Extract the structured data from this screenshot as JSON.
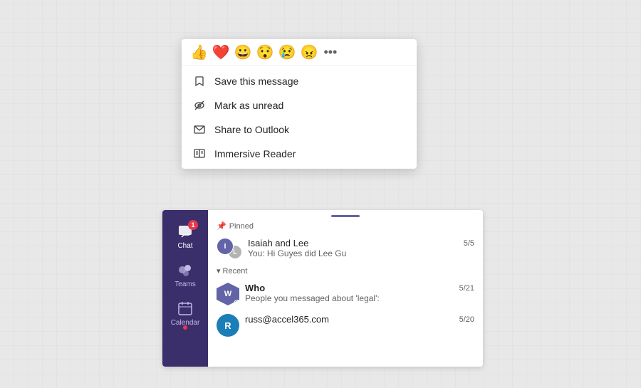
{
  "popup": {
    "reactions": [
      "👍",
      "❤️",
      "😀",
      "😯",
      "😢",
      "😠"
    ],
    "more_icon": "•••",
    "menu_items": [
      {
        "id": "save",
        "label": "Save this message",
        "icon": "bookmark"
      },
      {
        "id": "unread",
        "label": "Mark as unread",
        "icon": "eye-slash"
      },
      {
        "id": "outlook",
        "label": "Share to Outlook",
        "icon": "envelope"
      },
      {
        "id": "immersive",
        "label": "Immersive Reader",
        "icon": "reader"
      }
    ]
  },
  "sidebar": {
    "items": [
      {
        "id": "chat",
        "label": "Chat",
        "badge": "1",
        "icon": "chat"
      },
      {
        "id": "teams",
        "label": "Teams",
        "badge": null,
        "icon": "teams"
      },
      {
        "id": "calendar",
        "label": "Calendar",
        "badge": null,
        "icon": "calendar",
        "dot": true
      }
    ]
  },
  "chat_list": {
    "header_bar": true,
    "sections": [
      {
        "id": "pinned",
        "label": "Pinned",
        "items": [
          {
            "name": "Isaiah and Lee",
            "date": "5/5",
            "preview": "You: Hi Guyes did Lee Gu",
            "bold": false
          }
        ]
      },
      {
        "id": "recent",
        "label": "Recent",
        "items": [
          {
            "name": "Who",
            "date": "5/21",
            "preview": "People you messaged about 'legal':",
            "bold": true
          },
          {
            "name": "russ@accel365.com",
            "date": "5/20",
            "preview": "",
            "bold": false
          }
        ]
      }
    ]
  }
}
